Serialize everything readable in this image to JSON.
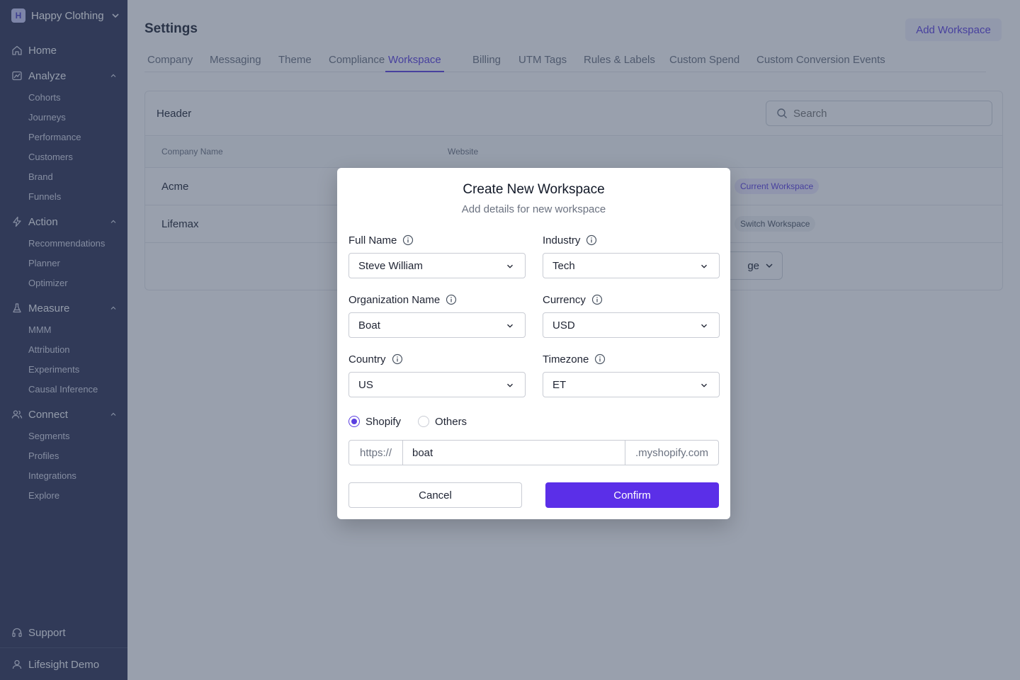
{
  "sidebar": {
    "workspace_initial": "H",
    "workspace_name": "Happy Clothing",
    "home": "Home",
    "analyze": {
      "label": "Analyze",
      "items": [
        "Cohorts",
        "Journeys",
        "Performance",
        "Customers",
        "Brand",
        "Funnels"
      ]
    },
    "action": {
      "label": "Action",
      "items": [
        "Recommendations",
        "Planner",
        "Optimizer"
      ]
    },
    "measure": {
      "label": "Measure",
      "items": [
        "MMM",
        "Attribution",
        "Experiments",
        "Causal Inference"
      ]
    },
    "connect": {
      "label": "Connect",
      "items": [
        "Segments",
        "Profiles",
        "Integrations",
        "Explore"
      ]
    },
    "support": "Support",
    "user": "Lifesight Demo"
  },
  "page": {
    "title": "Settings",
    "add_workspace": "Add Workspace",
    "tabs": [
      "Company",
      "Messaging",
      "Theme",
      "Compliance",
      "Workspace",
      "Billing",
      "UTM Tags",
      "Rules & Labels",
      "Custom Spend",
      "Custom Conversion Events"
    ],
    "active_tab": "Workspace"
  },
  "card": {
    "title": "Header",
    "search_placeholder": "Search",
    "columns": {
      "company": "Company Name",
      "website": "Website"
    },
    "rows": [
      {
        "name": "Acme",
        "action": "Current Workspace"
      },
      {
        "name": "Lifemax",
        "action": "Switch Workspace"
      }
    ],
    "per_page_fragment": "ge"
  },
  "modal": {
    "title": "Create New Workspace",
    "subtitle": "Add details for new workspace",
    "full_name": {
      "label": "Full Name",
      "value": "Steve William"
    },
    "industry": {
      "label": "Industry",
      "value": "Tech"
    },
    "org_name": {
      "label": "Organization Name",
      "value": "Boat"
    },
    "currency": {
      "label": "Currency",
      "value": "USD"
    },
    "country": {
      "label": "Country",
      "value": "US"
    },
    "timezone": {
      "label": "Timezone",
      "value": "ET"
    },
    "platform": {
      "shopify": "Shopify",
      "others": "Others",
      "selected": "Shopify"
    },
    "url": {
      "prefix": "https://",
      "value": "boat",
      "suffix": ".myshopify.com"
    },
    "cancel": "Cancel",
    "confirm": "Confirm"
  },
  "colors": {
    "accent": "#5b3fe0",
    "sidebar_bg": "#2e3354",
    "overlay": "#33415b"
  }
}
